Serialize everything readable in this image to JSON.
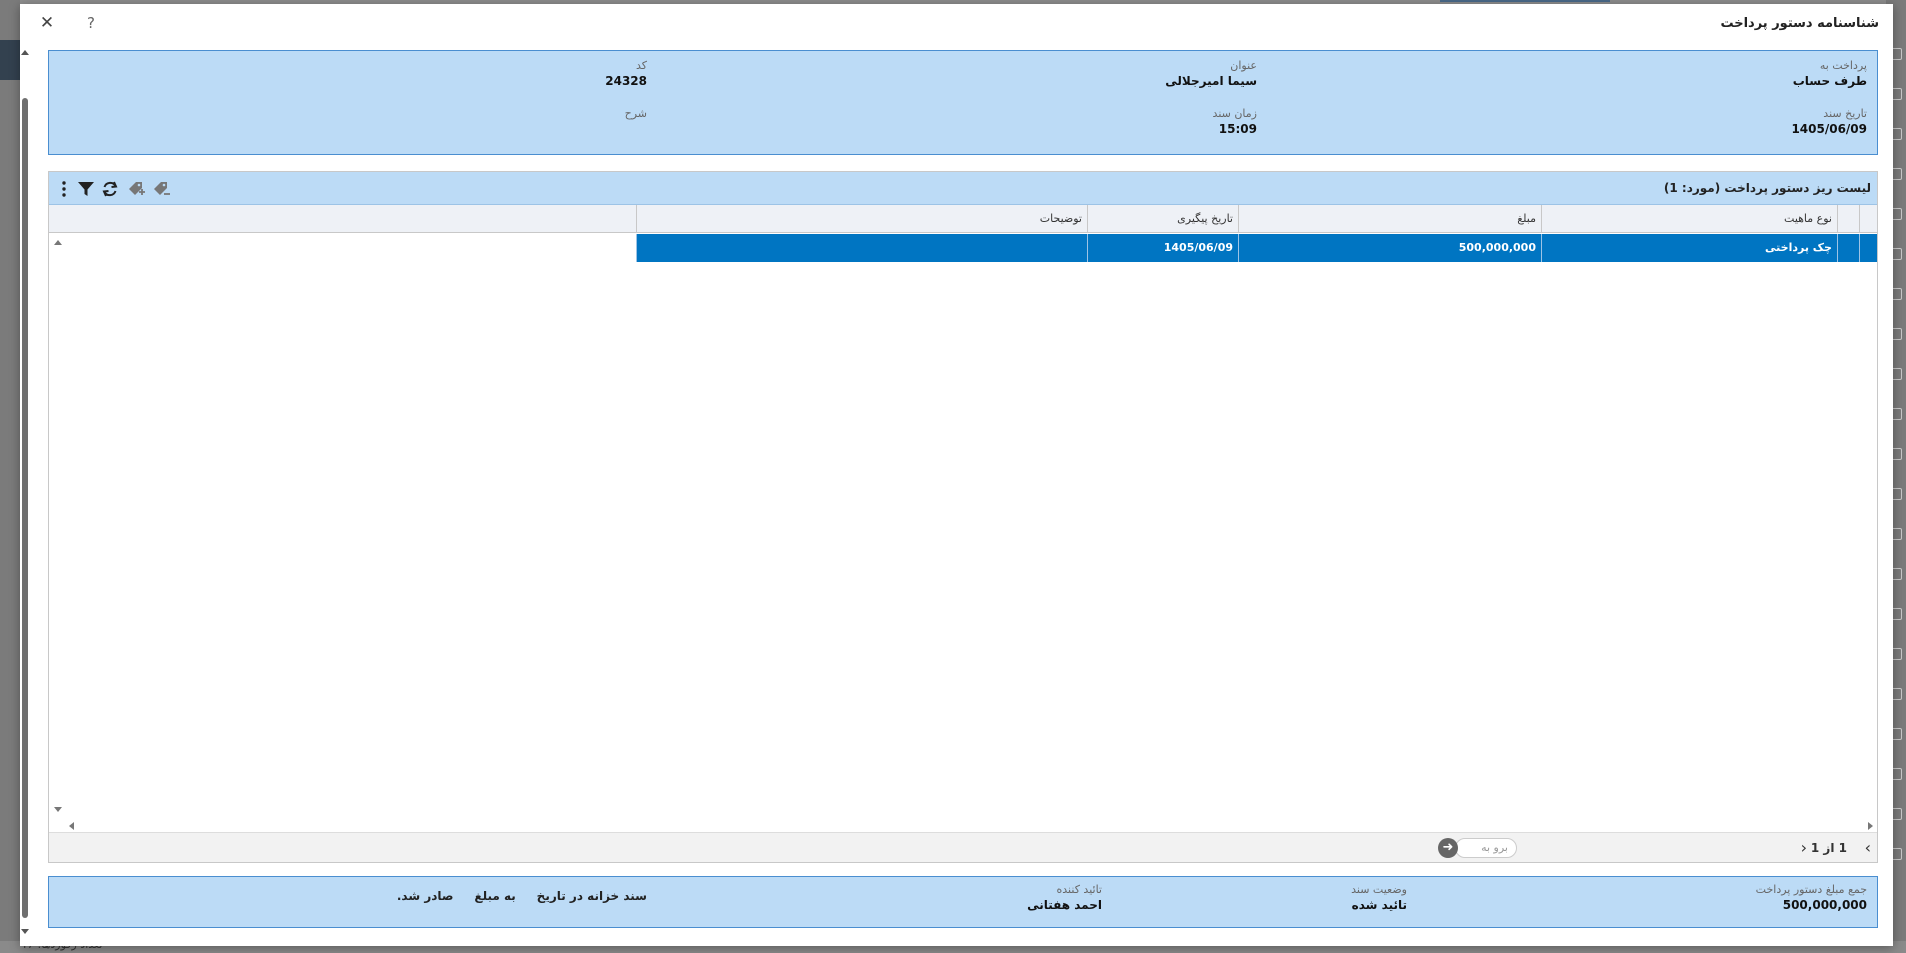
{
  "modal": {
    "title": "شناسنامه دستور پرداخت",
    "close_symbol": "✕",
    "help_symbol": "?"
  },
  "info": {
    "pay_to_label": "پرداخت به",
    "pay_to_value": "طرف حساب",
    "title_label": "عنوان",
    "title_value": "سیما امیرجلالی",
    "code_label": "کد",
    "code_value": "24328",
    "doc_date_label": "تاریخ سند",
    "doc_date_value": "1405/06/09",
    "doc_time_label": "زمان سند",
    "doc_time_value": "15:09",
    "desc_label": "شرح"
  },
  "grid": {
    "title": "لیست ریز دستور پرداخت (مورد: 1)",
    "toolbar_icons": [
      "more-vertical-icon",
      "filter-icon",
      "refresh-icon",
      "tag-add-icon",
      "tag-remove-icon"
    ],
    "columns": [
      "نوع ماهیت",
      "مبلغ",
      "تاریخ پیگیری",
      "توضیحات"
    ],
    "rows": [
      {
        "type": "چک پرداختی",
        "amount": "500,000,000",
        "followup_date": "1405/06/09",
        "notes": ""
      }
    ]
  },
  "pager": {
    "info": "1 از 1",
    "goto_placeholder": "برو به",
    "goto_symbol": "➜"
  },
  "footer": {
    "total_label": "جمع مبلغ دستور پرداخت",
    "total_value": "500,000,000",
    "status_label": "وضعیت سند",
    "status_value": "تائید شده",
    "approver_label": "تائید کننده",
    "approver_value": "احمد هفتانی",
    "treasury_text_1": "سند خزانه در تاریخ",
    "treasury_text_2": "به مبلغ",
    "treasury_text_3": "صادر شد."
  },
  "background": {
    "bottom_text": "تعداد رکوردها: 47"
  },
  "colors": {
    "panel_bg": "#bcdbf6",
    "panel_border": "#4a8ed0",
    "selected_row": "#0075c2"
  }
}
